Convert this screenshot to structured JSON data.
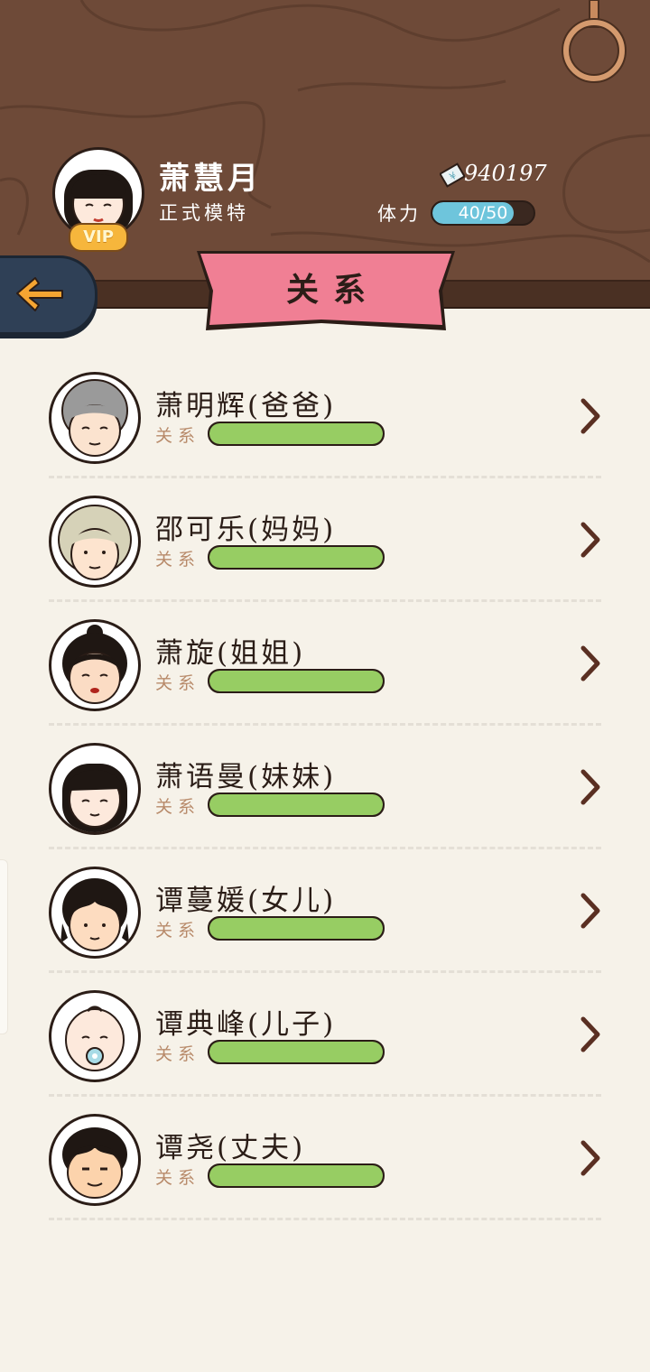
{
  "player": {
    "name": "萧慧月",
    "title": "正式模特",
    "vip_label": "VIP",
    "money_icon": "banknote-icon",
    "money": "940197",
    "stamina_label": "体力",
    "stamina_text": "40/50",
    "stamina_current": 40,
    "stamina_max": 50
  },
  "header": {
    "ribbon_title": "关系",
    "back_icon": "back-arrow-icon"
  },
  "relation_label": "关系",
  "relations": [
    {
      "name": "萧明辉(爸爸)",
      "relation_level": 1.0
    },
    {
      "name": "邵可乐(妈妈)",
      "relation_level": 1.0
    },
    {
      "name": "萧旋(姐姐)",
      "relation_level": 1.0
    },
    {
      "name": "萧语曼(妹妹)",
      "relation_level": 1.0
    },
    {
      "name": "谭蔓媛(女儿)",
      "relation_level": 1.0
    },
    {
      "name": "谭典峰(儿子)",
      "relation_level": 1.0
    },
    {
      "name": "谭尧(丈夫)",
      "relation_level": 1.0
    }
  ],
  "colors": {
    "wood": "#6e4a38",
    "background": "#f6f2e9",
    "ribbon": "#f07f94",
    "relation_bar": "#97cd63",
    "stamina_bar": "#6ec5dc"
  }
}
